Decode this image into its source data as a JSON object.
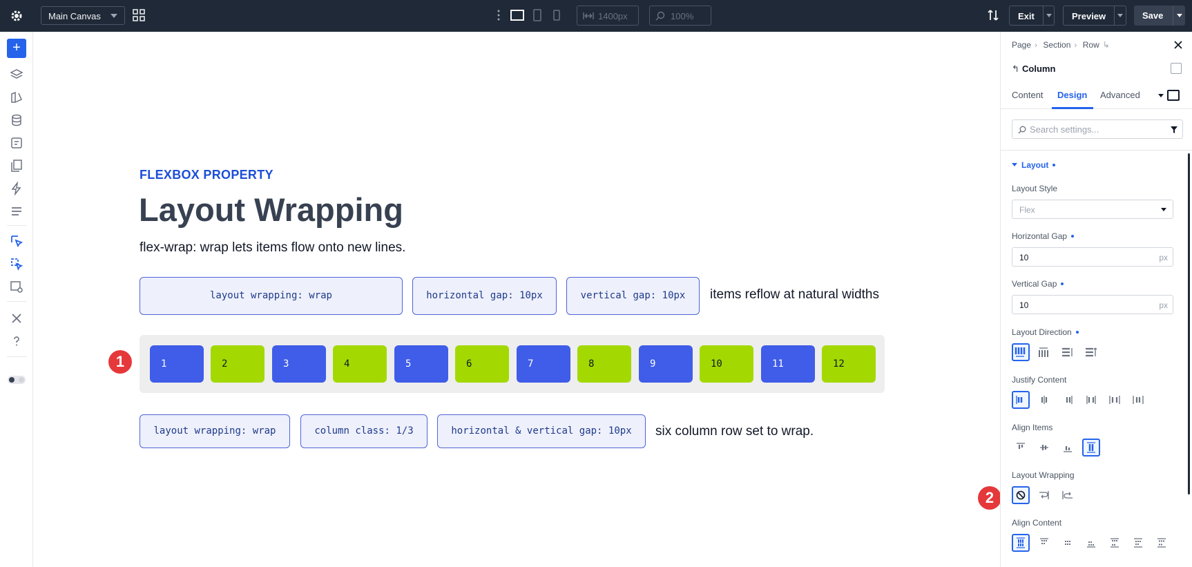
{
  "toolbar": {
    "canvas_select": "Main Canvas",
    "width_value": "1400px",
    "zoom_value": "100%",
    "exit_label": "Exit",
    "preview_label": "Preview",
    "save_label": "Save"
  },
  "canvas": {
    "kicker": "FLEXBOX PROPERTY",
    "title": "Layout Wrapping",
    "subtitle": "flex-wrap: wrap lets items flow onto new lines.",
    "tags_top": [
      "layout wrapping: wrap",
      "horizontal gap: 10px",
      "vertical gap: 10px"
    ],
    "note_top": "items reflow at natural widths",
    "items": [
      "1",
      "2",
      "3",
      "4",
      "5",
      "6",
      "7",
      "8",
      "9",
      "10",
      "11",
      "12"
    ],
    "tags_bottom": [
      "layout wrapping: wrap",
      "column class: 1/3",
      "horizontal & vertical gap: 10px"
    ],
    "note_bottom": "six column row set to wrap.",
    "markers": [
      "1",
      "2"
    ],
    "colors": {
      "blue_item": "#3f5de8",
      "green_item": "#a3d900",
      "accent": "#2563eb",
      "marker": "#e5383b"
    }
  },
  "panel": {
    "breadcrumbs": [
      "Page",
      "Section",
      "Row"
    ],
    "element_title": "Column",
    "tabs": [
      "Content",
      "Design",
      "Advanced"
    ],
    "search_placeholder": "Search settings...",
    "section": "Layout",
    "layout_style_label": "Layout Style",
    "layout_style_value": "Flex",
    "horizontal_gap_label": "Horizontal Gap",
    "horizontal_gap_value": "10",
    "vertical_gap_label": "Vertical Gap",
    "vertical_gap_value": "10",
    "unit": "px",
    "layout_direction_label": "Layout Direction",
    "justify_content_label": "Justify Content",
    "align_items_label": "Align Items",
    "layout_wrapping_label": "Layout Wrapping",
    "align_content_label": "Align Content"
  }
}
